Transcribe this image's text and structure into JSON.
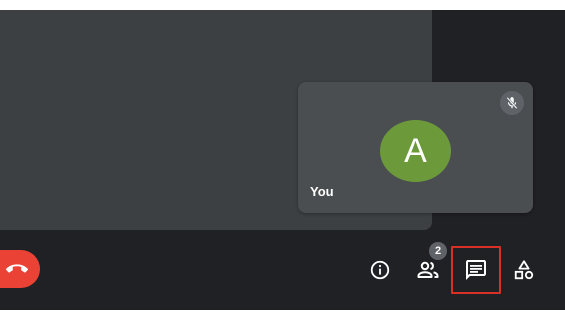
{
  "self_tile": {
    "avatar_letter": "A",
    "name": "You",
    "avatar_color": "#6c9a3b",
    "mic_state": "muted"
  },
  "controls": {
    "end_call_icon": "phone-hangup-icon",
    "info_icon": "info-icon",
    "people_icon": "people-icon",
    "people_count": "2",
    "chat_icon": "chat-icon",
    "activities_icon": "activities-icon",
    "highlighted": "chat"
  },
  "colors": {
    "end_call": "#ea4335",
    "highlight_border": "#d93025",
    "background": "#202124",
    "tile": "#3c4043"
  }
}
